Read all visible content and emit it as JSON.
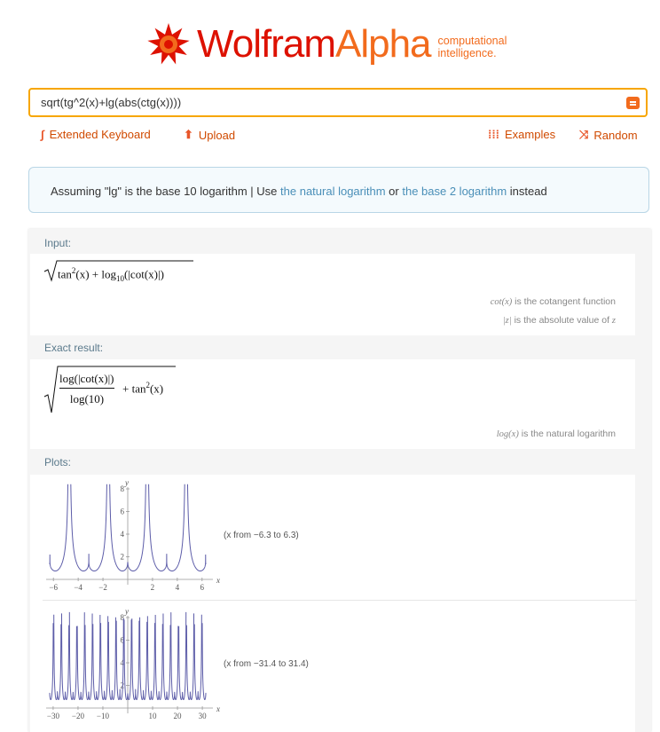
{
  "header": {
    "brand_wolfram": "Wolfram",
    "brand_alpha": "Alpha",
    "tagline_1": "computational",
    "tagline_2": "intelligence."
  },
  "search": {
    "query": "sqrt(tg^2(x)+lg(abs(ctg(x))))"
  },
  "toolbar": {
    "extended_keyboard": "Extended Keyboard",
    "upload": "Upload",
    "examples": "Examples",
    "random": "Random"
  },
  "assumption": {
    "prefix": "Assuming \"lg\" is the base 10 logarithm | Use",
    "option_1": "the natural logarithm",
    "or": "or",
    "option_2": "the base 2 logarithm",
    "suffix": "instead"
  },
  "pods": {
    "input": {
      "title": "Input:",
      "expr_tan": "tan",
      "expr_x1": "(x) + log",
      "expr_sub": "10",
      "expr_rest": "(|cot(x)|)",
      "note_1_sym": "cot(x)",
      "note_1_text": "is the cotangent function",
      "note_2_sym": "|z|",
      "note_2_text": "is the absolute value of",
      "note_2_var": "z"
    },
    "exact": {
      "title": "Exact result:",
      "numerator": "log(|cot(x)|)",
      "denominator": "log(10)",
      "plus": "+ tan",
      "x": "(x)",
      "note_sym": "log(x)",
      "note_text": "is the natural logarithm"
    },
    "plots": {
      "title": "Plots:",
      "range_1": "(x from −6.3 to 6.3)",
      "range_2": "(x from −31.4 to 31.4)"
    }
  },
  "colors": {
    "accent": "#dd1100",
    "orange": "#f26b1d",
    "link": "#4a8fb8",
    "curve": "#5c5ca8"
  },
  "chart_data": [
    {
      "type": "line",
      "function": "sqrt(tan^2(x) + log10(|cot(x)|))",
      "x_range": [
        -6.3,
        6.3
      ],
      "ylim": [
        0,
        8
      ],
      "xlabel": "x",
      "ylabel": "y",
      "x_ticks": [
        -6,
        -4,
        -2,
        2,
        4,
        6
      ],
      "y_ticks": [
        2,
        4,
        6,
        8
      ]
    },
    {
      "type": "line",
      "function": "sqrt(tan^2(x) + log10(|cot(x)|))",
      "x_range": [
        -31.4,
        31.4
      ],
      "ylim": [
        0,
        8
      ],
      "xlabel": "x",
      "ylabel": "y",
      "x_ticks": [
        -30,
        -20,
        -10,
        10,
        20,
        30
      ],
      "y_ticks": [
        2,
        4,
        6,
        8
      ]
    }
  ]
}
